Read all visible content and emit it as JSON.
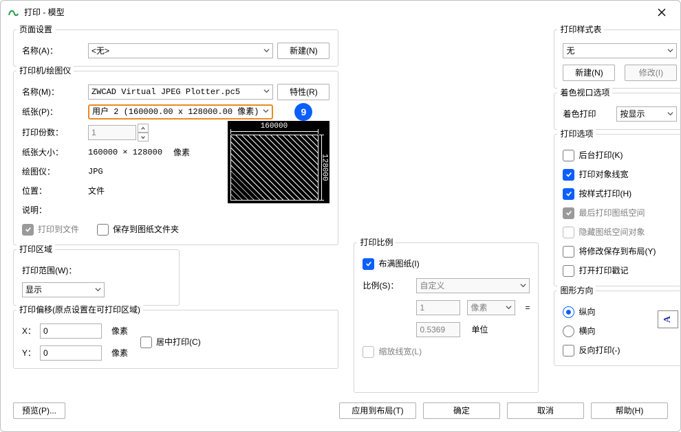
{
  "window": {
    "title": "打印 - 模型"
  },
  "page_setup": {
    "legend": "页面设置",
    "name_label": "名称(A)：",
    "name_value": "<无>",
    "new_btn": "新建(N)"
  },
  "printer": {
    "legend": "打印机/绘图仪",
    "name_label": "名称(M)：",
    "name_value": "ZWCAD Virtual JPEG Plotter.pc5",
    "props_btn": "特性(R)",
    "paper_label": "纸张(P)：",
    "paper_value": "用户 2 (160000.00 x 128000.00 像素)",
    "step_number": "9",
    "copies_label": "打印份数：",
    "copies_value": "1",
    "papersize_label": "纸张大小：",
    "papersize_value": "160000 × 128000",
    "papersize_unit": "像素",
    "plotter_label": "绘图仪：",
    "plotter_value": "JPG",
    "location_label": "位置：",
    "location_value": "文件",
    "desc_label": "说明：",
    "preview_top": "160000",
    "preview_right": "128000",
    "print_to_file": "打印到文件",
    "save_to_folder": "保存到图纸文件夹"
  },
  "area": {
    "legend": "打印区域",
    "scope_label": "打印范围(W)：",
    "scope_value": "显示"
  },
  "offset": {
    "legend": "打印偏移(原点设置在可打印区域)",
    "x_label": "X：",
    "y_label": "Y：",
    "x_value": "0",
    "y_value": "0",
    "unit": "像素",
    "center": "居中打印(C)"
  },
  "scale": {
    "legend": "打印比例",
    "fit": "布满图纸(I)",
    "ratio_label": "比例(S)：",
    "ratio_value": "自定义",
    "pix_value": "1",
    "pix_unit": "像素",
    "equals": "=",
    "unit_value": "0.5369",
    "unit_label": "单位",
    "scale_lw": "缩放线宽(L)"
  },
  "style": {
    "legend": "打印样式表",
    "value": "无",
    "new_btn": "新建(N)",
    "modify_btn": "修改(I)"
  },
  "shade": {
    "legend": "着色视口选项",
    "label": "着色打印",
    "value": "按显示"
  },
  "options": {
    "legend": "打印选项",
    "bg": "后台打印(K)",
    "lw": "打印对象线宽",
    "style": "按样式打印(H)",
    "last_ps": "最后打印图纸空间",
    "hide_ps": "隐藏图纸空间对象",
    "save_layout": "将修改保存到布局(Y)",
    "stamp": "打开打印戳记"
  },
  "orient": {
    "legend": "图形方向",
    "portrait": "纵向",
    "landscape": "横向",
    "reverse": "反向打印(-)",
    "icon_letter": "A"
  },
  "buttons": {
    "preview": "预览(P)...",
    "apply": "应用到布局(T)",
    "ok": "确定",
    "cancel": "取消",
    "help": "帮助(H)"
  }
}
